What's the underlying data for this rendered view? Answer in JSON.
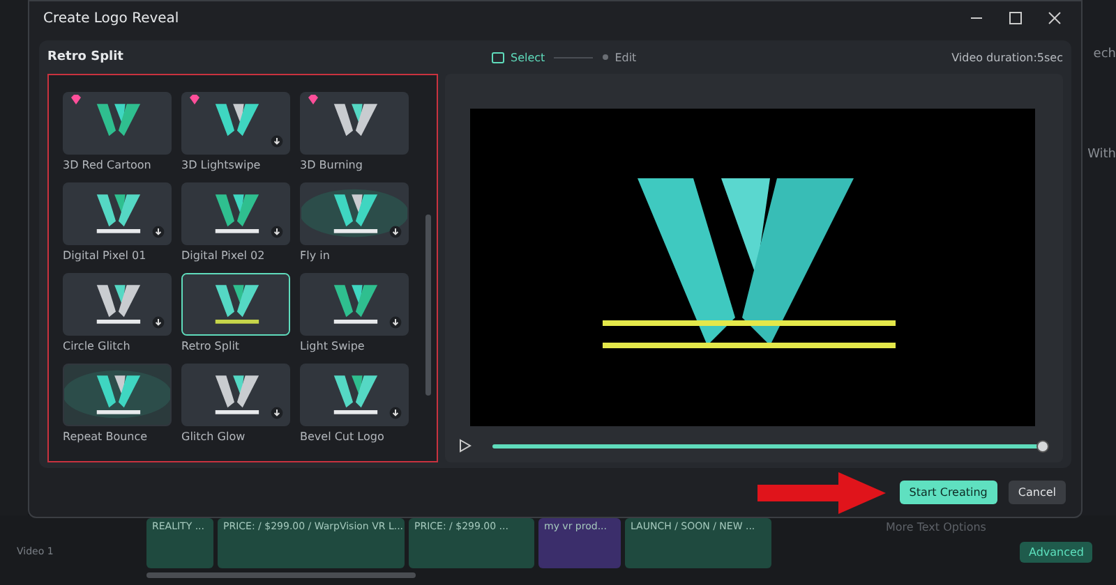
{
  "window": {
    "title": "Create Logo Reveal"
  },
  "header": {
    "title": "Retro Split",
    "steps": [
      {
        "label": "Select",
        "selected": true
      },
      {
        "label": "Edit",
        "selected": false
      }
    ],
    "duration": "Video duration:5sec"
  },
  "templates": [
    {
      "name": "3D Red Cartoon",
      "premium": true,
      "download": false,
      "selected": false
    },
    {
      "name": "3D Lightswipe",
      "premium": true,
      "download": true,
      "selected": false
    },
    {
      "name": "3D Burning",
      "premium": true,
      "download": false,
      "selected": false
    },
    {
      "name": "Digital Pixel 01",
      "premium": false,
      "download": true,
      "selected": false
    },
    {
      "name": "Digital Pixel 02",
      "premium": false,
      "download": true,
      "selected": false
    },
    {
      "name": "Fly in",
      "premium": false,
      "download": true,
      "selected": false
    },
    {
      "name": "Circle Glitch",
      "premium": false,
      "download": true,
      "selected": false
    },
    {
      "name": "Retro Split",
      "premium": false,
      "download": false,
      "selected": true
    },
    {
      "name": "Light Swipe",
      "premium": false,
      "download": true,
      "selected": false
    },
    {
      "name": "Repeat Bounce",
      "premium": false,
      "download": false,
      "selected": false
    },
    {
      "name": "Glitch Glow",
      "premium": false,
      "download": true,
      "selected": false
    },
    {
      "name": "Bevel Cut Logo",
      "premium": false,
      "download": true,
      "selected": false
    }
  ],
  "player": {
    "level": 1
  },
  "buttons": [
    {
      "label": "Start Creating",
      "kind": "primary"
    },
    {
      "label": "Cancel",
      "kind": "secondary"
    }
  ],
  "background": {
    "side_texts": [
      "ech",
      "With"
    ],
    "track": "Video 1",
    "clips": [
      {
        "label": "REALITY ...",
        "kind": "text"
      },
      {
        "label": "PRICE: / $299.00 / WarpVision VR L...",
        "kind": "text"
      },
      {
        "label": "PRICE: / $299.00 ...",
        "kind": "text"
      },
      {
        "label": "my vr prod..."
      },
      {
        "label": "LAUNCH / SOON / NEW ...",
        "kind": "text"
      }
    ],
    "more_options": "More Text Options",
    "advanced": "Advanced"
  }
}
